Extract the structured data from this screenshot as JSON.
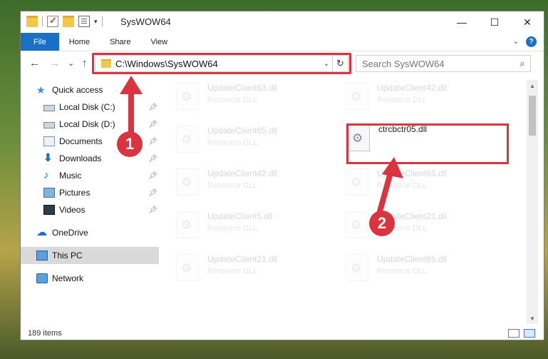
{
  "window": {
    "title": "SysWOW64",
    "controls": [
      "—",
      "☐",
      "✕"
    ]
  },
  "ribbon": {
    "tabs": [
      "File",
      "Home",
      "Share",
      "View"
    ]
  },
  "nav": {
    "back": "←",
    "forward": "→",
    "recent": "⌄",
    "up": "↑"
  },
  "address": {
    "path": "C:\\Windows\\SysWOW64"
  },
  "search": {
    "placeholder": "Search SysWOW64"
  },
  "sidebar": {
    "items": [
      {
        "label": "Quick access",
        "icon": "star-icon",
        "pinned": false
      },
      {
        "label": "Local Disk (C:)",
        "icon": "drive-icon",
        "pinned": true
      },
      {
        "label": "Local Disk (D:)",
        "icon": "drive-icon",
        "pinned": true
      },
      {
        "label": "Documents",
        "icon": "documents-icon",
        "pinned": true
      },
      {
        "label": "Downloads",
        "icon": "download-icon",
        "pinned": true
      },
      {
        "label": "Music",
        "icon": "music-icon",
        "pinned": true
      },
      {
        "label": "Pictures",
        "icon": "pictures-icon",
        "pinned": true
      },
      {
        "label": "Videos",
        "icon": "videos-icon",
        "pinned": true
      },
      {
        "label": "OneDrive",
        "icon": "cloud-icon",
        "pinned": false
      },
      {
        "label": "This PC",
        "icon": "computer-icon",
        "pinned": false,
        "selected": true
      },
      {
        "label": "Network",
        "icon": "network-icon",
        "pinned": false
      }
    ]
  },
  "files": [
    {
      "name": "UpdateClient63.dll",
      "type": "Resource DLL",
      "faded": true
    },
    {
      "name": "UpdateClient42.dll",
      "type": "Resource DLL",
      "faded": true
    },
    {
      "name": "UpdateClient65.dll",
      "type": "Resource DLL",
      "faded": true
    },
    {
      "name": "ctrcbctr05.dll",
      "type": "",
      "faded": false
    },
    {
      "name": "UpdateClient42.dll",
      "type": "Resource DLL",
      "faded": true
    },
    {
      "name": "UpdateClient65.dll",
      "type": "Resource DLL",
      "faded": true
    },
    {
      "name": "UpdateClient5.dll",
      "type": "Resource DLL",
      "faded": true
    },
    {
      "name": "UpdateClient21.dll",
      "type": "Resource DLL",
      "faded": true
    },
    {
      "name": "UpdateClient21.dll",
      "type": "Resource DLL",
      "faded": true
    },
    {
      "name": "UpdateClient65.dll",
      "type": "Resource DLL",
      "faded": true
    }
  ],
  "status": {
    "count": "189 items"
  },
  "annotations": {
    "badge1": "1",
    "badge2": "2",
    "color": "#d9343f"
  }
}
